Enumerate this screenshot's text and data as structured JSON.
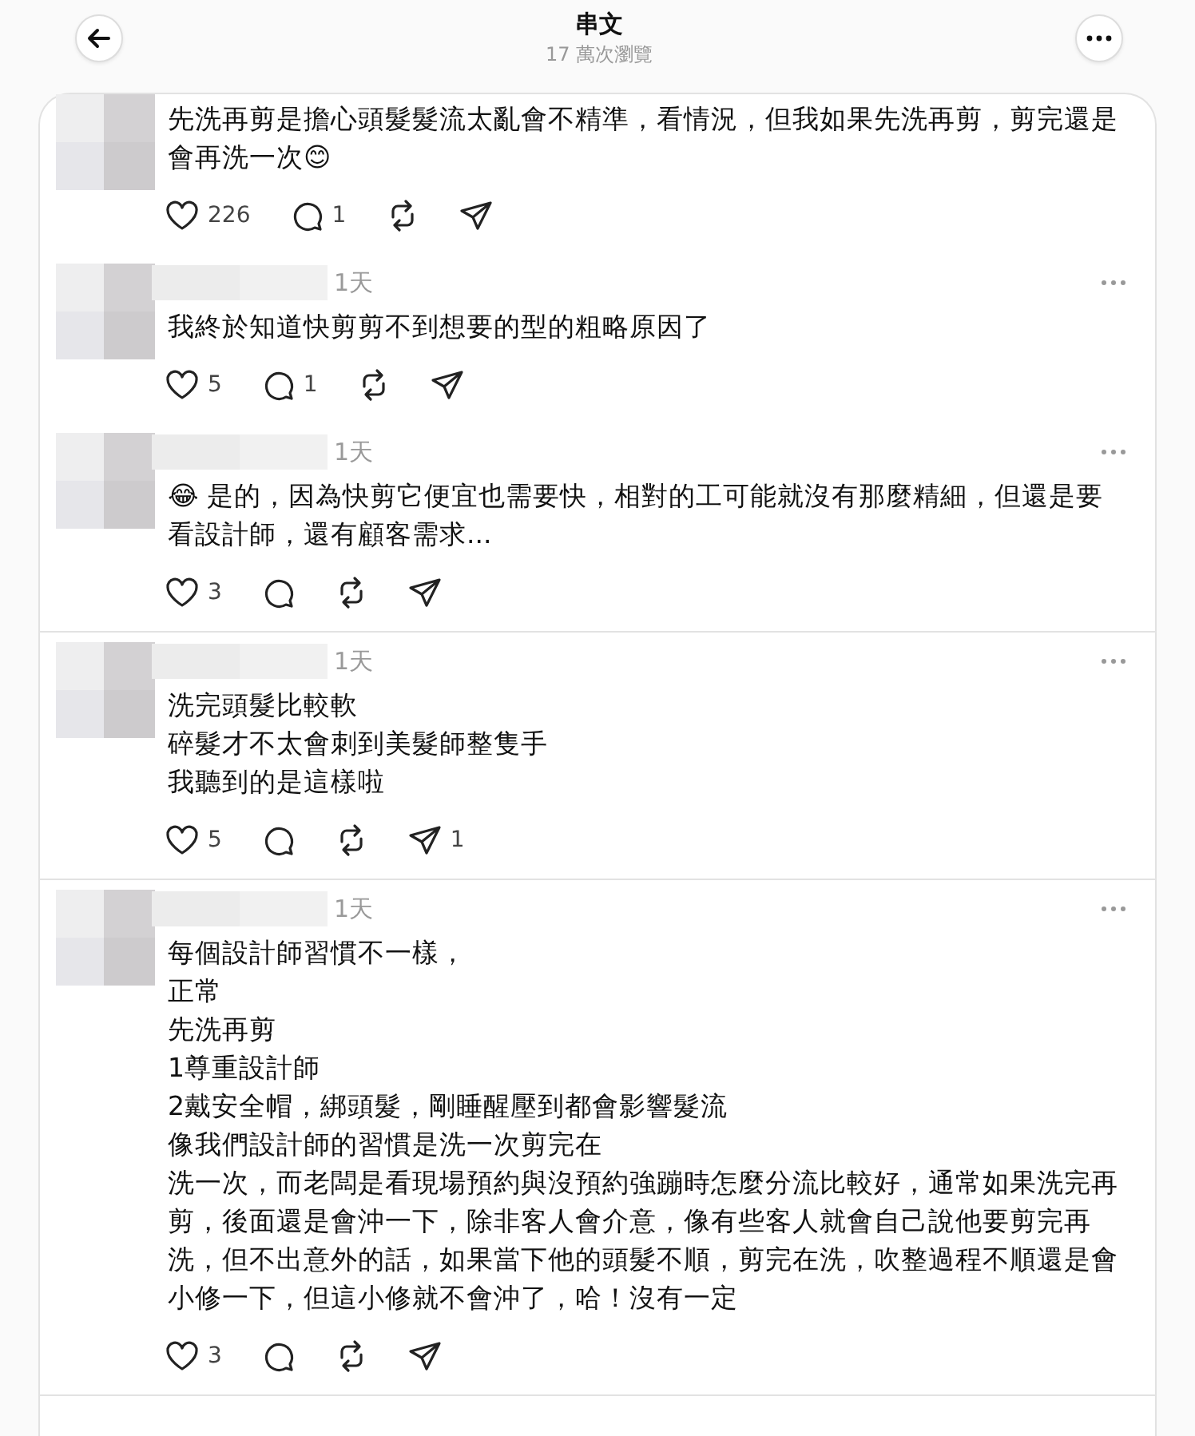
{
  "header": {
    "title": "串文",
    "views": "17 萬次瀏覽"
  },
  "threads": [
    {
      "posts": [
        {
          "lines": [
            "先洗再剪是擔心頭髮髮流太亂會不精準，看情況，但我如果先洗再剪，剪完還是會再洗一次😊"
          ],
          "likes": "226",
          "replies": "1"
        },
        {
          "time": "1天",
          "lines": [
            "我終於知道快剪剪不到想要的型的粗略原因了"
          ],
          "likes": "5",
          "replies": "1"
        },
        {
          "time": "1天",
          "lines": [
            "😂 是的，因為快剪它便宜也需要快，相對的工可能就沒有那麼精細，但還是要看設計師，還有顧客需求..."
          ],
          "likes": "3"
        }
      ]
    },
    {
      "posts": [
        {
          "time": "1天",
          "lines": [
            "洗完頭髮比較軟",
            "碎髮才不太會刺到美髮師整隻手",
            "我聽到的是這樣啦"
          ],
          "likes": "5",
          "shares": "1"
        }
      ]
    },
    {
      "posts": [
        {
          "time": "1天",
          "lines": [
            "每個設計師習慣不一樣，",
            "正常",
            "先洗再剪",
            "1尊重設計師",
            "2戴安全帽，綁頭髮，剛睡醒壓到都會影響髮流",
            "像我們設計師的習慣是洗一次剪完在",
            "洗一次，而老闆是看現場預約與沒預約強蹦時怎麼分流比較好，通常如果洗完再剪，後面還是會沖一下，除非客人會介意，像有些客人就會自己說他要剪完再洗，但不出意外的話，如果當下他的頭髮不順，剪完在洗，吹整過程不順還是會小修一下，但這小修就不會沖了，哈！沒有一定"
          ],
          "likes": "3"
        }
      ]
    }
  ]
}
